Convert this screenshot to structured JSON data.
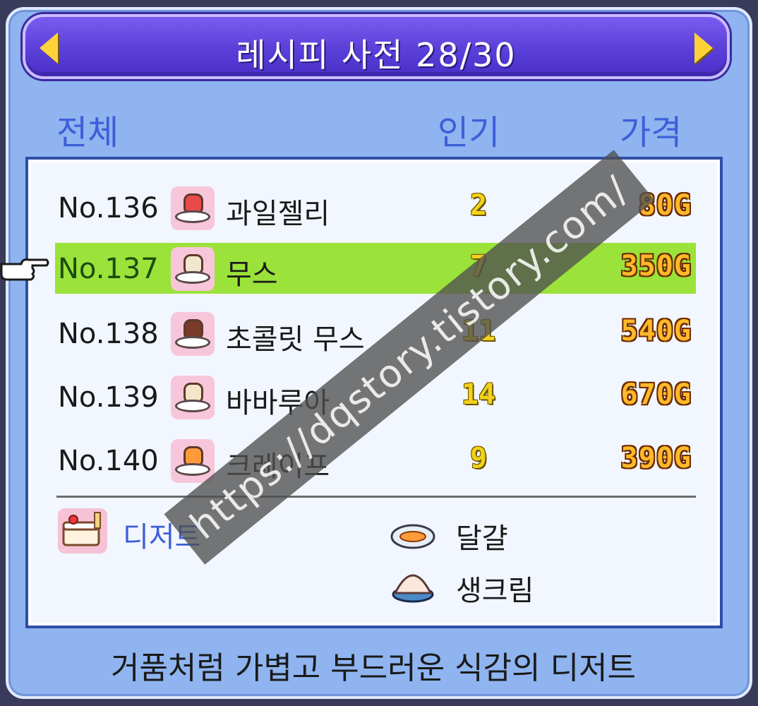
{
  "title": "레시피 사전 28/30",
  "columns": {
    "all": "전체",
    "popularity": "인기",
    "price": "가격"
  },
  "rows": [
    {
      "no": "No.136",
      "name": "과일젤리",
      "popularity": "2",
      "price": "80G",
      "food_color": "#e84a4a",
      "selected": false
    },
    {
      "no": "No.137",
      "name": "무스",
      "popularity": "7",
      "price": "350G",
      "food_color": "#f3e6cf",
      "selected": true
    },
    {
      "no": "No.138",
      "name": "초콜릿 무스",
      "popularity": "11",
      "price": "540G",
      "food_color": "#7a3a2a",
      "selected": false
    },
    {
      "no": "No.139",
      "name": "바바루아",
      "popularity": "14",
      "price": "670G",
      "food_color": "#f4e4c8",
      "selected": false
    },
    {
      "no": "No.140",
      "name": "크레이프",
      "popularity": "9",
      "price": "390G",
      "food_color": "#ff9a3a",
      "selected": false
    }
  ],
  "category": {
    "label": "디저트",
    "icon": "cake-icon"
  },
  "ingredients": [
    {
      "label": "달걀",
      "icon": "egg-plate-icon"
    },
    {
      "label": "생크림",
      "icon": "cream-bowl-icon"
    }
  ],
  "description": "거품처럼 가볍고 부드러운 식감의 디저트",
  "watermark": "https://dqstory.tistory.com/",
  "colors": {
    "selected_row": "#9be23a",
    "header_text": "#3d5fd8",
    "title_bar": "#5a3fd8"
  }
}
